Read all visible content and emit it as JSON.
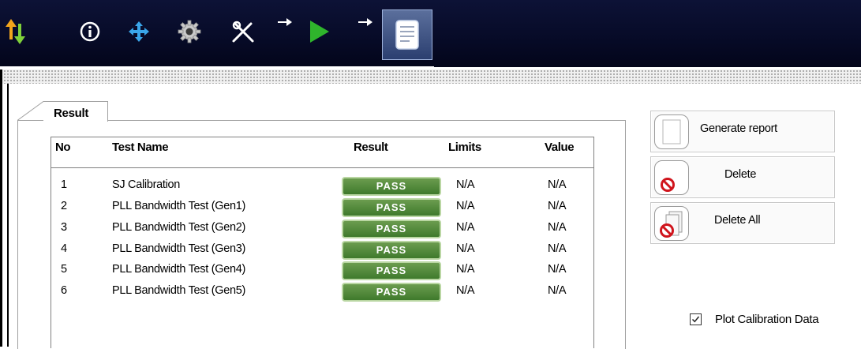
{
  "toolbar": {
    "icons": [
      "arrows-updown-icon",
      "info-icon",
      "move-icon",
      "gear-icon",
      "tools-icon",
      "arrow-right-icon",
      "play-icon",
      "arrow-right-icon",
      "report-icon"
    ]
  },
  "tabs": [
    {
      "label": "Result",
      "active": true
    }
  ],
  "table": {
    "columns": [
      "No",
      "Test Name",
      "Result",
      "Limits",
      "Value"
    ],
    "rows": [
      {
        "no": "1",
        "name": "SJ Calibration",
        "result": "PASS",
        "limits": "N/A",
        "value": "N/A"
      },
      {
        "no": "2",
        "name": "PLL Bandwidth Test (Gen1)",
        "result": "PASS",
        "limits": "N/A",
        "value": "N/A"
      },
      {
        "no": "3",
        "name": "PLL Bandwidth Test (Gen2)",
        "result": "PASS",
        "limits": "N/A",
        "value": "N/A"
      },
      {
        "no": "4",
        "name": "PLL Bandwidth Test (Gen3)",
        "result": "PASS",
        "limits": "N/A",
        "value": "N/A"
      },
      {
        "no": "5",
        "name": "PLL Bandwidth Test (Gen4)",
        "result": "PASS",
        "limits": "N/A",
        "value": "N/A"
      },
      {
        "no": "6",
        "name": "PLL Bandwidth Test (Gen5)",
        "result": "PASS",
        "limits": "N/A",
        "value": "N/A"
      }
    ]
  },
  "buttons": {
    "generate_report": "Generate report",
    "delete": "Delete",
    "delete_all": "Delete All"
  },
  "options": {
    "plot_calibration_label": "Plot Calibration Data",
    "plot_calibration_checked": true
  },
  "colors": {
    "pass_badge": "#4e8a36",
    "toolbar_bg": "#070b28"
  }
}
